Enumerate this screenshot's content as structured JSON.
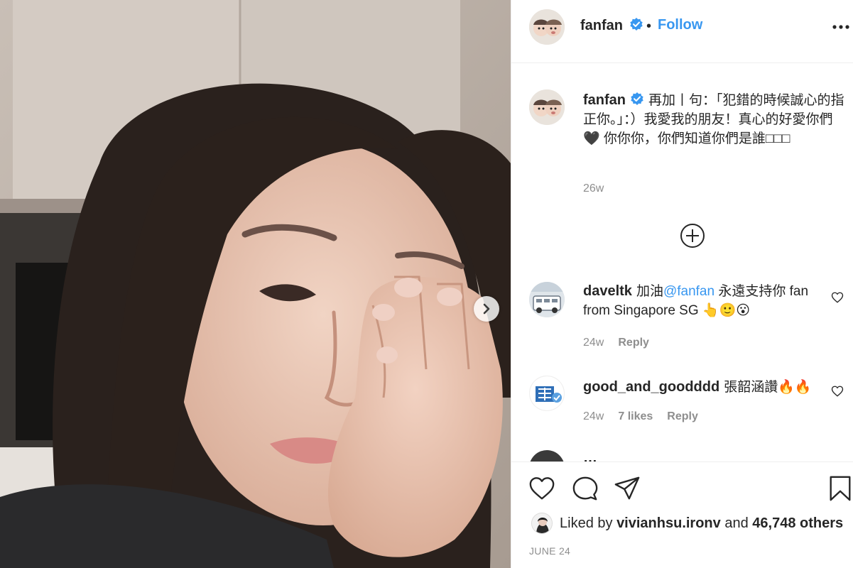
{
  "post": {
    "author": "fanfan",
    "follow_label": "Follow",
    "separator": "•",
    "caption": "再加丨句：「犯錯的時候誠心的指正你。」：）我愛我的朋友！真心的好愛你們🖤 你你你，你們知道你們是誰□□□",
    "caption_age": "26w",
    "load_more_icon": "plus-circle-icon"
  },
  "comments": [
    {
      "username": "daveltk",
      "text_prefix": "加油",
      "mention": "@fanfan",
      "text_suffix": " 永遠支持你 fan from Singapore SG 👆🙂😮",
      "age": "24w",
      "likes": "",
      "reply_label": "Reply"
    },
    {
      "username": "good_and_goodddd",
      "text": "張韶涵讚🔥🔥",
      "age": "24w",
      "likes": "7 likes",
      "reply_label": "Reply"
    },
    {
      "username": "…",
      "text": "",
      "age": "",
      "likes": "",
      "reply_label": ""
    }
  ],
  "footer": {
    "liked_by_prefix": "Liked by",
    "liked_by_user": "vivianhsu.ironv",
    "liked_by_and": "and",
    "liked_by_others": "46,748 others",
    "date": "JUNE 24"
  },
  "icons": {
    "like": "heart-icon",
    "comment": "comment-bubble-icon",
    "share": "paper-plane-icon",
    "save": "bookmark-icon",
    "more": "more-horizontal-icon",
    "next": "chevron-right-icon",
    "verified": "verified-badge-icon"
  },
  "colors": {
    "link": "#3897f0",
    "verified": "#3897f0",
    "muted": "#8e8e8e",
    "text": "#262626",
    "border": "#efefef"
  }
}
